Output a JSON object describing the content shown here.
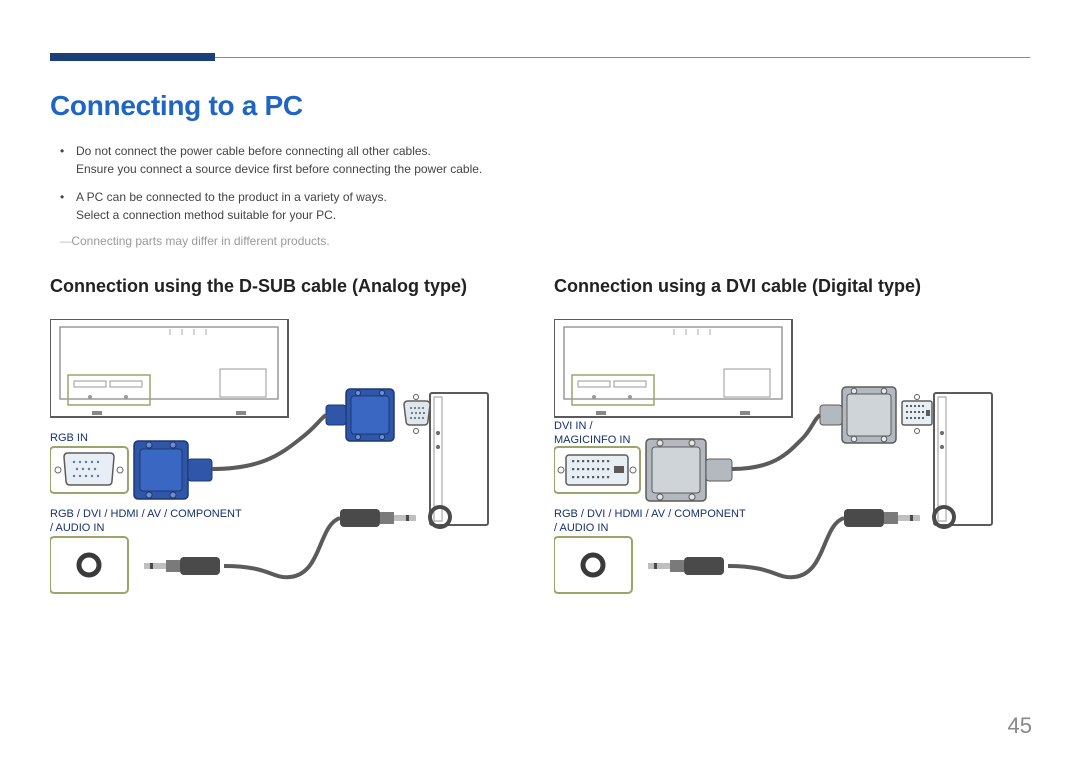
{
  "page_title": "Connecting to a PC",
  "bullets": [
    {
      "line1": "Do not connect the power cable before connecting all other cables.",
      "line2": "Ensure you connect a source device first before connecting the power cable."
    },
    {
      "line1": "A PC can be connected to the product in a variety of ways.",
      "line2": "Select a connection method suitable for your PC."
    }
  ],
  "note": "Connecting parts may differ in different products.",
  "left": {
    "heading": "Connection using the D-SUB cable (Analog type)",
    "port1": "RGB IN",
    "port2a": "RGB / DVI / HDMI / AV / COMPONENT",
    "port2b": "/ AUDIO IN"
  },
  "right": {
    "heading": "Connection using a DVI cable (Digital type)",
    "port1a": "DVI IN /",
    "port1b": "MAGICINFO IN",
    "port2a": "RGB / DVI / HDMI / AV / COMPONENT",
    "port2b": "/ AUDIO IN"
  },
  "page_number": "45"
}
